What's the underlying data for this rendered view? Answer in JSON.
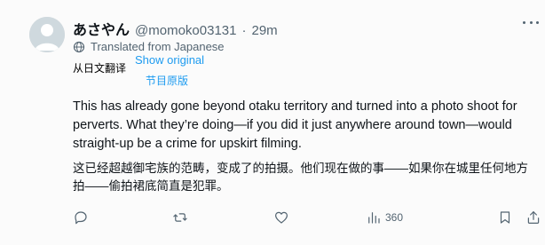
{
  "post": {
    "author": {
      "display_name": "あさやん",
      "handle": "@momoko03131",
      "separator": "·",
      "time": "29m"
    },
    "translation_notice": "Translated from Japanese",
    "cn_translation_notice": "从日文翻译",
    "show_original": "Show original",
    "cn_show_original": "节目原版",
    "body_en": "This has already gone beyond otaku territory and turned into a photo shoot for perverts. What they’re doing—if you did it just anywhere around town—would straight-up be a crime for upskirt filming.",
    "body_cn": "这已经超越御宅族的范畴，变成了的拍摄。他们现在做的事——如果你在城里任何地方拍——偷拍裙底简直是犯罪。",
    "actions": {
      "views_count": "360"
    },
    "icons": {
      "more": "more-icon",
      "globe": "globe-icon",
      "reply": "reply-icon",
      "retweet": "retweet-icon",
      "like": "heart-icon",
      "views": "views-icon",
      "bookmark": "bookmark-icon",
      "share": "share-icon"
    },
    "colors": {
      "link": "#1d9bf0",
      "muted": "#536471",
      "text": "#0f1419"
    }
  }
}
